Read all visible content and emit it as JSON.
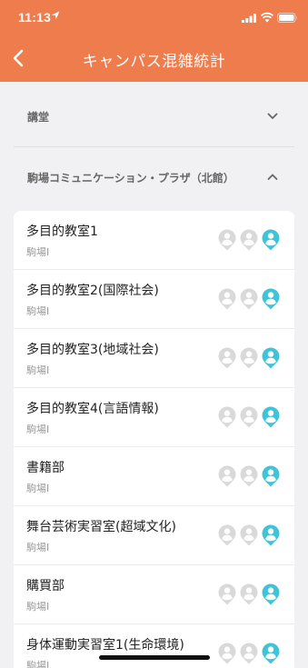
{
  "status_bar": {
    "time": "11:13"
  },
  "header": {
    "title": "キャンパス混雑統計"
  },
  "sections": [
    {
      "label": "講堂",
      "expanded": false
    },
    {
      "label": "駒場コミュニケーション・プラザ（北館）",
      "expanded": true
    }
  ],
  "rooms": [
    {
      "name": "多目的教室1",
      "sub": "駒場I"
    },
    {
      "name": "多目的教室2(国際社会)",
      "sub": "駒場I"
    },
    {
      "name": "多目的教室3(地域社会)",
      "sub": "駒場I"
    },
    {
      "name": "多目的教室4(言語情報)",
      "sub": "駒場I"
    },
    {
      "name": "書籍部",
      "sub": "駒場I"
    },
    {
      "name": "舞台芸術実習室(超域文化)",
      "sub": "駒場I"
    },
    {
      "name": "購買部",
      "sub": "駒場I"
    },
    {
      "name": "身体運動実習室1(生命環境)",
      "sub": "駒場I"
    }
  ],
  "crowd_level": 1,
  "crowd_max": 3,
  "colors": {
    "accent": "#ee7c4d",
    "person_active": "#3fc3d9",
    "person_inactive": "#d9d9d9"
  }
}
